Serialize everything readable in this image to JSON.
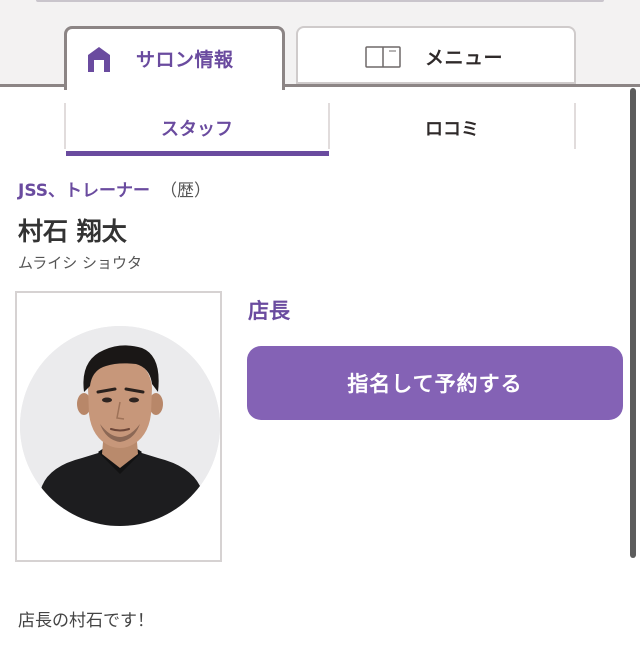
{
  "tabs": {
    "salon_info": {
      "label": "サロン情報",
      "icon": "home-icon",
      "active": true
    },
    "menu": {
      "label": "メニュー",
      "icon": "menu-card-icon",
      "active": false
    }
  },
  "subtabs": {
    "staff": {
      "label": "スタッフ",
      "active": true
    },
    "reviews": {
      "label": "ロコミ",
      "active": false
    }
  },
  "staff": {
    "role": "JSS、トレーナー",
    "experience": "（歴）",
    "name": "村石 翔太",
    "name_kana": "ムライシ ショウタ",
    "position": "店長",
    "reserve_button": "指名して予約する",
    "message": "店長の村石です！",
    "photo": "staff-portrait"
  },
  "colors": {
    "accent": "#6a4b9f",
    "button": "#8462b5",
    "text": "#333333",
    "border": "#8c8585"
  }
}
